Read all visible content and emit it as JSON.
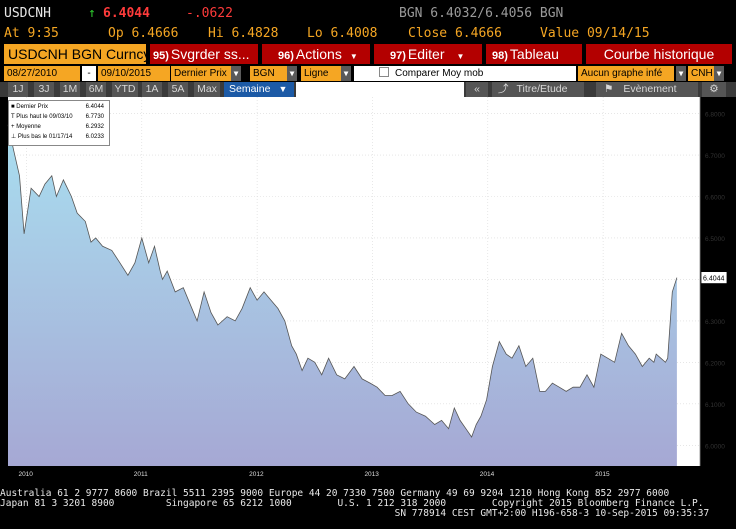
{
  "quote": {
    "ticker": "USDCNH",
    "arrow": "↑",
    "last": "6.4044",
    "change": "-.0622",
    "source_quotes": "BGN  6.4032/6.4056  BGN",
    "at": "At 9:35",
    "open": "Op 6.4666",
    "high": "Hi 6.4828",
    "low": "Lo 6.4008",
    "close": "Close 6.4666",
    "value": "Value 09/14/15"
  },
  "menu": {
    "security": "USDCNH BGN Curncy",
    "items": [
      {
        "num": "95)",
        "label": "Svgrder ss..."
      },
      {
        "num": "96)",
        "label": "Actions"
      },
      {
        "num": "97)",
        "label": "Editer"
      },
      {
        "num": "98)",
        "label": "Tableau"
      }
    ],
    "title": "Courbe historique"
  },
  "controls": {
    "start_date": "08/27/2010",
    "dash": "-",
    "end_date": "09/10/2015",
    "field": "Dernier Prix",
    "source": "BGN",
    "style": "Ligne",
    "compare": "Comparer Moy mob",
    "lower": "Aucun graphe infé",
    "currency": "CNH"
  },
  "periods": [
    "1J",
    "3J",
    "1M",
    "6M",
    "YTD",
    "1A",
    "5A",
    "Max"
  ],
  "frequency": "Semaine",
  "toolbar": {
    "collapse": "«",
    "titles": "Titre/Etude",
    "events": "Evènement",
    "settings_icon": "gear-icon",
    "title_icon": "chart-line-icon",
    "event_icon": "flag-icon"
  },
  "legend": [
    {
      "marker": "■",
      "label": "Dernier Prix",
      "value": "6.4044"
    },
    {
      "marker": "T",
      "label": "Plus haut le 09/03/10",
      "value": "6.7730"
    },
    {
      "marker": "+",
      "label": "Moyenne",
      "value": "6.2932"
    },
    {
      "marker": "⊥",
      "label": "Plus bas le 01/17/14",
      "value": "6.0233"
    }
  ],
  "chart_data": {
    "type": "area",
    "ylim": [
      5.95,
      6.84
    ],
    "yticks": [
      "6.8000",
      "6.7000",
      "6.6000",
      "6.5000",
      "6.4000",
      "6.3000",
      "6.2000",
      "6.1000",
      "6.0000"
    ],
    "xlim": [
      2010.0,
      2015.87
    ],
    "xticks": [
      {
        "x": 2010.16,
        "label": "2010"
      },
      {
        "x": 2011.16,
        "label": "2011"
      },
      {
        "x": 2012.16,
        "label": "2012"
      },
      {
        "x": 2013.16,
        "label": "2013"
      },
      {
        "x": 2014.16,
        "label": "2014"
      },
      {
        "x": 2015.16,
        "label": "2015"
      }
    ],
    "last_label": "6.4044",
    "x": [
      2010.0,
      2010.05,
      2010.1,
      2010.14,
      2010.2,
      2010.27,
      2010.32,
      2010.38,
      2010.42,
      2010.48,
      2010.55,
      2010.6,
      2010.67,
      2010.72,
      2010.76,
      2010.82,
      2010.9,
      2010.97,
      2011.04,
      2011.1,
      2011.16,
      2011.22,
      2011.27,
      2011.32,
      2011.34,
      2011.38,
      2011.45,
      2011.52,
      2011.58,
      2011.64,
      2011.7,
      2011.76,
      2011.82,
      2011.9,
      2011.97,
      2012.03,
      2012.1,
      2012.16,
      2012.22,
      2012.28,
      2012.34,
      2012.4,
      2012.46,
      2012.5,
      2012.55,
      2012.6,
      2012.66,
      2012.72,
      2012.78,
      2012.85,
      2012.92,
      2013.0,
      2013.07,
      2013.14,
      2013.2,
      2013.27,
      2013.33,
      2013.4,
      2013.47,
      2013.54,
      2013.62,
      2013.7,
      2013.76,
      2013.82,
      2013.87,
      2013.92,
      2013.97,
      2014.02,
      2014.06,
      2014.1,
      2014.15,
      2014.2,
      2014.26,
      2014.32,
      2014.37,
      2014.43,
      2014.49,
      2014.55,
      2014.61,
      2014.66,
      2014.72,
      2014.78,
      2014.84,
      2014.9,
      2014.96,
      2015.02,
      2015.08,
      2015.14,
      2015.2,
      2015.26,
      2015.32,
      2015.38,
      2015.44,
      2015.5,
      2015.56,
      2015.6,
      2015.62,
      2015.66,
      2015.7,
      2015.72,
      2015.76,
      2015.8
    ],
    "y": [
      6.773,
      6.71,
      6.65,
      6.51,
      6.62,
      6.6,
      6.63,
      6.65,
      6.6,
      6.64,
      6.6,
      6.56,
      6.54,
      6.49,
      6.5,
      6.48,
      6.47,
      6.44,
      6.41,
      6.44,
      6.5,
      6.44,
      6.48,
      6.42,
      6.4,
      6.42,
      6.37,
      6.38,
      6.34,
      6.3,
      6.37,
      6.32,
      6.29,
      6.31,
      6.3,
      6.33,
      6.38,
      6.35,
      6.37,
      6.35,
      6.33,
      6.3,
      6.24,
      6.22,
      6.18,
      6.21,
      6.2,
      6.17,
      6.21,
      6.17,
      6.16,
      6.19,
      6.16,
      6.15,
      6.14,
      6.12,
      6.12,
      6.13,
      6.1,
      6.08,
      6.07,
      6.05,
      6.06,
      6.04,
      6.09,
      6.06,
      6.04,
      6.02,
      6.05,
      6.07,
      6.11,
      6.19,
      6.25,
      6.22,
      6.21,
      6.24,
      6.19,
      6.21,
      6.13,
      6.13,
      6.15,
      6.14,
      6.13,
      6.14,
      6.14,
      6.17,
      6.14,
      6.22,
      6.21,
      6.2,
      6.27,
      6.24,
      6.22,
      6.19,
      6.21,
      6.2,
      6.22,
      6.21,
      6.2,
      6.21,
      6.37,
      6.4044
    ]
  },
  "footer": {
    "line1": "Australia 61 2 9777 8600 Brazil 5511 2395 9000 Europe 44 20 7330 7500 Germany 49 69 9204 1210 Hong Kong 852 2977 6000",
    "line2": "Japan 81 3 3201 8900         Singapore 65 6212 1000        U.S. 1 212 318 2000        Copyright 2015 Bloomberg Finance L.P.",
    "line3": "                                                                     SN 778914 CEST GMT+2:00 H196-658-3 10-Sep-2015 09:35:37"
  },
  "colors": {
    "menu_red": "#b30000",
    "amber": "#f5a623",
    "selected_blue": "#1c5aa6",
    "area_top": "#a9dff0",
    "area_bottom": "#a6a8d4",
    "price_tag": "#ffffff"
  }
}
